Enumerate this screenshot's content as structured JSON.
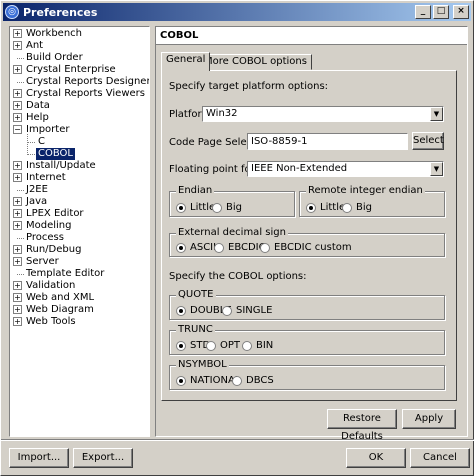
{
  "window": {
    "title": "Preferences",
    "app_icon": "eclipse-icon",
    "controls": {
      "minimize": "_",
      "maximize": "□",
      "close": "×"
    }
  },
  "tree": {
    "items": [
      {
        "label": "Workbench",
        "expandable": true
      },
      {
        "label": "Ant",
        "expandable": true
      },
      {
        "label": "Build Order",
        "expandable": false
      },
      {
        "label": "Crystal Enterprise",
        "expandable": true
      },
      {
        "label": "Crystal Reports Designer",
        "expandable": false
      },
      {
        "label": "Crystal Reports Viewers",
        "expandable": true
      },
      {
        "label": "Data",
        "expandable": true
      },
      {
        "label": "Help",
        "expandable": true
      },
      {
        "label": "Importer",
        "expandable": true,
        "expanded": true
      },
      {
        "label": "C",
        "child": true
      },
      {
        "label": "COBOL",
        "child": true,
        "selected": true
      },
      {
        "label": "Install/Update",
        "expandable": true
      },
      {
        "label": "Internet",
        "expandable": true
      },
      {
        "label": "J2EE",
        "expandable": false
      },
      {
        "label": "Java",
        "expandable": true
      },
      {
        "label": "LPEX Editor",
        "expandable": true
      },
      {
        "label": "Modeling",
        "expandable": true
      },
      {
        "label": "Process",
        "expandable": false
      },
      {
        "label": "Run/Debug",
        "expandable": true
      },
      {
        "label": "Server",
        "expandable": true
      },
      {
        "label": "Template Editor",
        "expandable": false
      },
      {
        "label": "Validation",
        "expandable": true
      },
      {
        "label": "Web and XML",
        "expandable": true
      },
      {
        "label": "Web Diagram",
        "expandable": true
      },
      {
        "label": "Web Tools",
        "expandable": true
      }
    ]
  },
  "page": {
    "title": "COBOL",
    "tabs": [
      {
        "label": "General",
        "active": true
      },
      {
        "label": "More COBOL options",
        "active": false
      }
    ],
    "target_heading": "Specify target platform options:",
    "platform": {
      "label": "Platform",
      "value": "Win32"
    },
    "codepage": {
      "label": "Code Page Selection",
      "value": "ISO-8859-1",
      "button": "Select"
    },
    "floating": {
      "label": "Floating point format",
      "value": "IEEE Non-Extended"
    },
    "endian": {
      "title": "Endian",
      "options": [
        "Little",
        "Big"
      ],
      "selected": "Little"
    },
    "remote_endian": {
      "title": "Remote integer endian",
      "options": [
        "Little",
        "Big"
      ],
      "selected": "Little"
    },
    "decimal": {
      "title": "External decimal sign",
      "options": [
        "ASCII",
        "EBCDIC",
        "EBCDIC custom"
      ],
      "selected": "ASCII"
    },
    "cobol_heading": "Specify the COBOL options:",
    "quote": {
      "title": "QUOTE",
      "options": [
        "DOUBLE",
        "SINGLE"
      ],
      "selected": "DOUBLE"
    },
    "trunc": {
      "title": "TRUNC",
      "options": [
        "STD",
        "OPT",
        "BIN"
      ],
      "selected": "STD"
    },
    "nsymbol": {
      "title": "NSYMBOL",
      "options": [
        "NATIONAL",
        "DBCS"
      ],
      "selected": "NATIONAL"
    },
    "restore_label": "Restore Defaults",
    "apply_label": "Apply"
  },
  "footer": {
    "import_label": "Import...",
    "export_label": "Export...",
    "ok_label": "OK",
    "cancel_label": "Cancel"
  }
}
